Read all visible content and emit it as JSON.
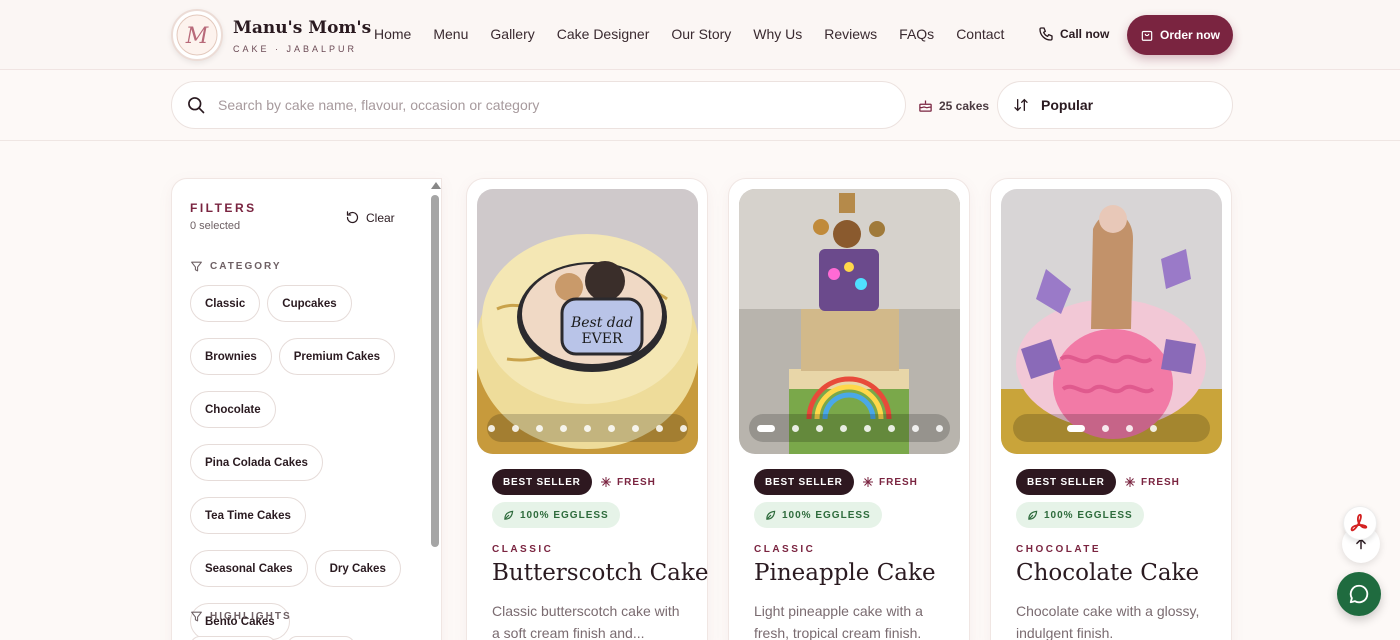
{
  "brand": {
    "name": "Manu's Mom's",
    "tagline": "CAKE · JABALPUR",
    "logo_initials": "M"
  },
  "nav": {
    "links": [
      "Home",
      "Menu",
      "Gallery",
      "Cake Designer",
      "Our Story",
      "Why Us",
      "Reviews",
      "FAQs",
      "Contact"
    ],
    "call_label": "Call now",
    "order_label": "Order now"
  },
  "search": {
    "placeholder": "Search by cake name, flavour, occasion or category",
    "value": "",
    "count_label": "25 cakes",
    "sort_label": "Popular"
  },
  "filters": {
    "title": "FILTERS",
    "selected_label": "0 selected",
    "clear_label": "Clear",
    "category_heading": "CATEGORY",
    "categories": [
      "Classic",
      "Cupcakes",
      "Brownies",
      "Premium Cakes",
      "Chocolate",
      "Pina Colada Cakes",
      "Tea Time Cakes",
      "Seasonal Cakes",
      "Dry Cakes",
      "Bento Cakes"
    ],
    "highlights_heading": "HIGHLIGHTS"
  },
  "products": [
    {
      "badge_best": "BEST SELLER",
      "badge_fresh": "FRESH",
      "badge_eggless": "100% EGGLESS",
      "category": "CLASSIC",
      "name": "Butterscotch Cake",
      "description": "Classic butterscotch cake with a soft cream finish and...",
      "image_caption": "Best dad EVER",
      "slides": 9,
      "active_slide": 0
    },
    {
      "badge_best": "BEST SELLER",
      "badge_fresh": "FRESH",
      "badge_eggless": "100% EGGLESS",
      "category": "CLASSIC",
      "name": "Pineapple Cake",
      "description": "Light pineapple cake with a fresh, tropical cream finish.",
      "slides": 8,
      "active_slide": 0
    },
    {
      "badge_best": "BEST SELLER",
      "badge_fresh": "FRESH",
      "badge_eggless": "100% EGGLESS",
      "category": "CHOCOLATE",
      "name": "Chocolate Cake",
      "description": "Chocolate cake with a glossy, indulgent finish.",
      "slides": 4,
      "active_slide": 0
    }
  ],
  "colors": {
    "accent": "#7a2440",
    "dark_badge": "#2e1820",
    "eggless_bg": "#e6f3e8",
    "eggless_text": "#2e6b3c",
    "chat_green": "#1f6b3f"
  },
  "icons": [
    "phone-icon",
    "bag-icon",
    "search-icon",
    "cake-icon",
    "sort-icon",
    "refresh-icon",
    "filter-icon",
    "sparkle-icon",
    "leaf-icon",
    "pdf-icon",
    "arrow-up-icon",
    "chat-icon"
  ]
}
